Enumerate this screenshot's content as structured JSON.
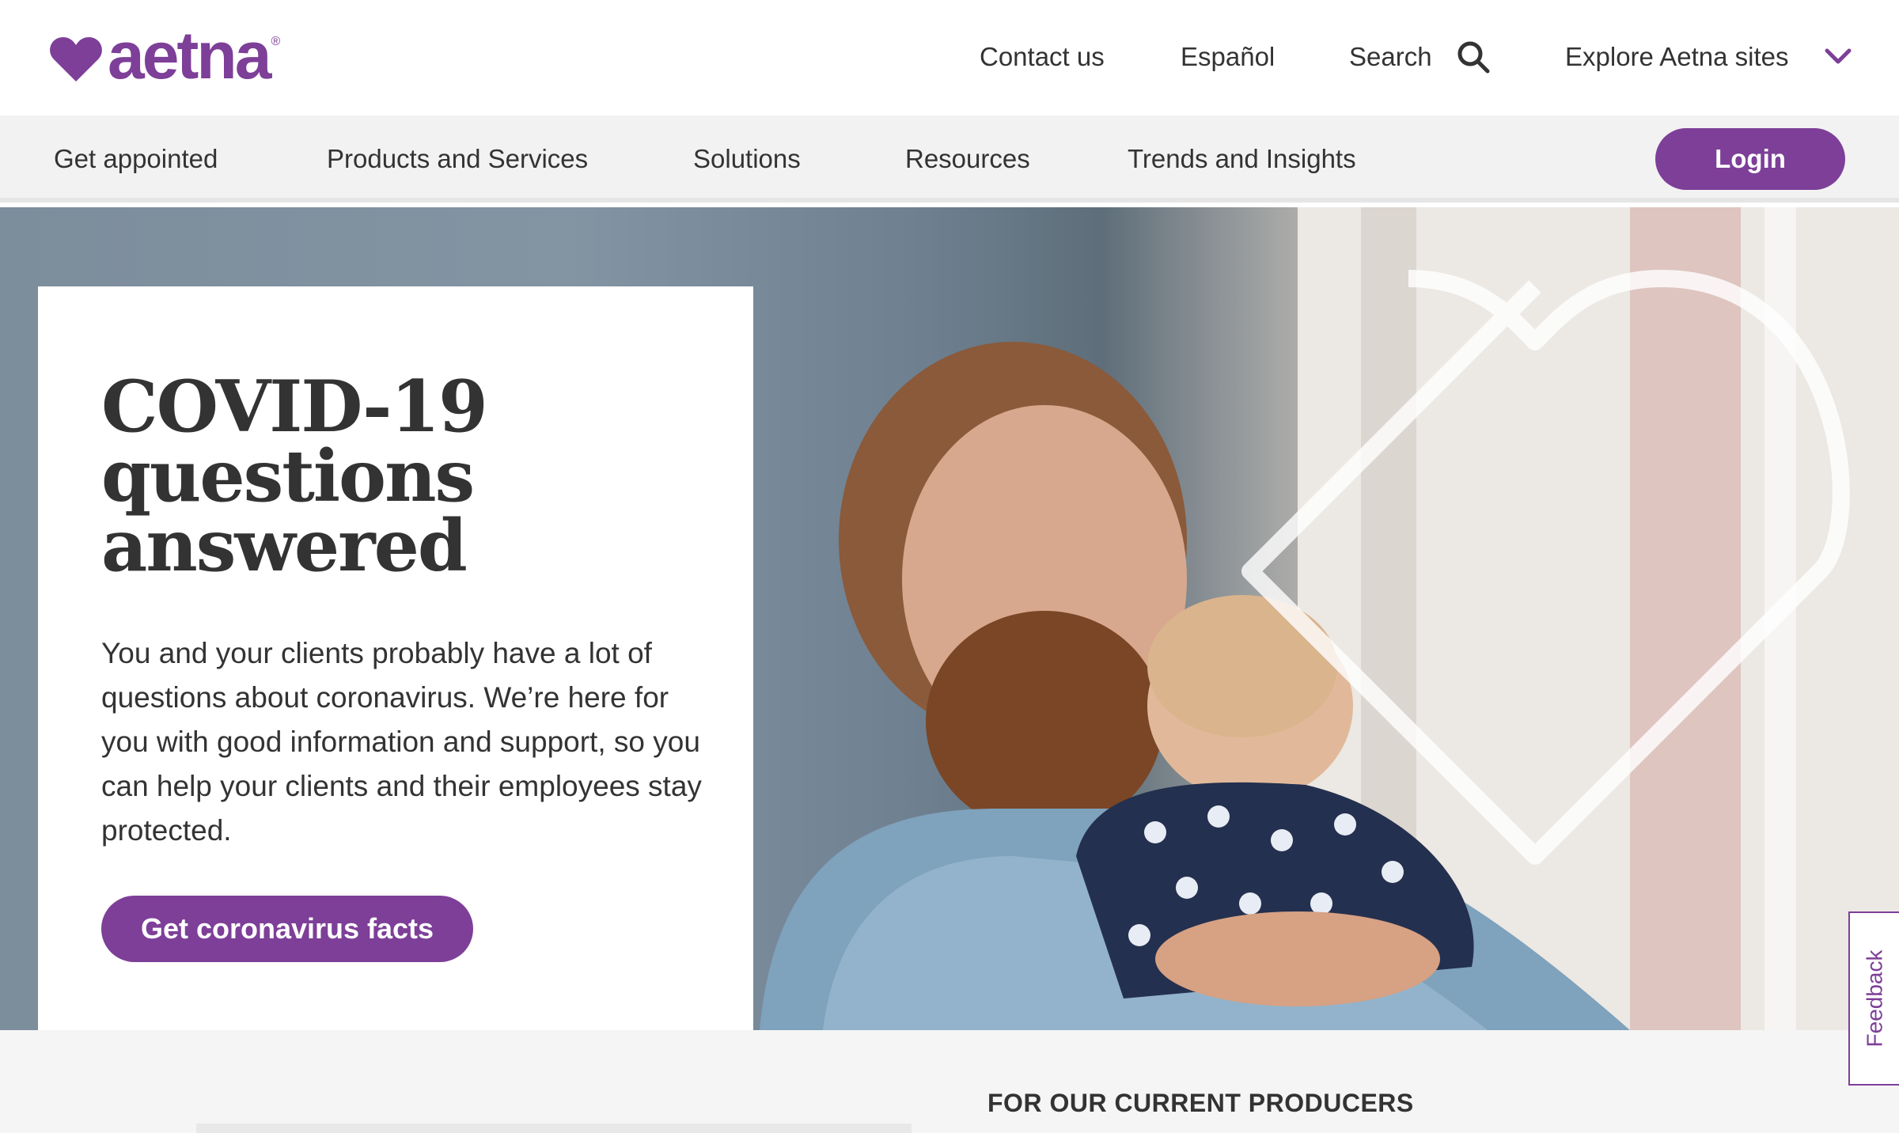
{
  "brand": {
    "logo_text": "aetna",
    "logo_mark": "®",
    "color": "#7d3f98"
  },
  "utility_nav": {
    "contact": "Contact us",
    "espanol": "Español",
    "search": "Search",
    "explore": "Explore Aetna sites"
  },
  "main_nav": {
    "items": [
      {
        "label": "Get appointed"
      },
      {
        "label": "Products and Services"
      },
      {
        "label": "Solutions"
      },
      {
        "label": "Resources"
      },
      {
        "label": "Trends and Insights"
      }
    ],
    "login": "Login"
  },
  "hero": {
    "title_lines": [
      "COVID-19",
      "questions",
      "answered"
    ],
    "body": "You and your clients probably have a lot of questions about coronavirus. We’re here for you with good information and support, so you can help your clients and their employees stay protected.",
    "cta": "Get coronavirus facts"
  },
  "lower": {
    "heading": "FOR OUR CURRENT PRODUCERS"
  },
  "feedback": {
    "label": "Feedback"
  },
  "icons": {
    "search": "search-icon",
    "explore": "chevron-down-icon",
    "logo": "heart-icon"
  }
}
